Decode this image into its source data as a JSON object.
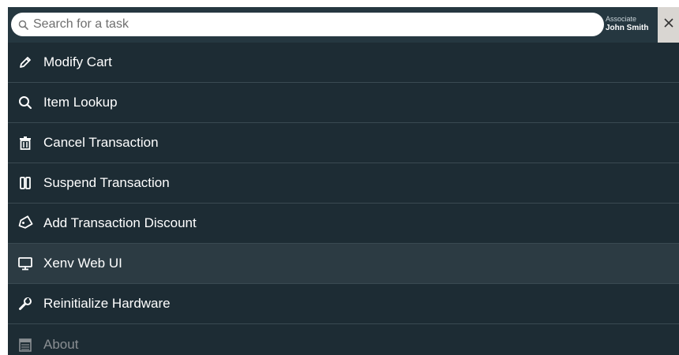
{
  "search": {
    "placeholder": "Search for a task",
    "icon": "search-icon"
  },
  "associate": {
    "label": "Associate",
    "name": "John Smith"
  },
  "close": {
    "icon": "close-icon",
    "glyph": "✕"
  },
  "menu": {
    "items": [
      {
        "label": "Modify Cart",
        "icon": "pencil-icon"
      },
      {
        "label": "Item Lookup",
        "icon": "search-icon"
      },
      {
        "label": "Cancel Transaction",
        "icon": "trash-icon"
      },
      {
        "label": "Suspend Transaction",
        "icon": "pause-icon"
      },
      {
        "label": "Add Transaction Discount",
        "icon": "tag-icon"
      },
      {
        "label": "Xenv Web UI",
        "icon": "monitor-icon",
        "highlighted": true
      },
      {
        "label": "Reinitialize Hardware",
        "icon": "wrench-icon"
      },
      {
        "label": "About",
        "icon": "calendar-icon",
        "disabled": true
      }
    ]
  },
  "colors": {
    "panel": "#1d2b33",
    "topbar": "#253740",
    "highlight_row": "#2c3b43",
    "close_button": "#d9d6d2",
    "text": "#ffffff",
    "muted_text": "#8a8f93"
  }
}
